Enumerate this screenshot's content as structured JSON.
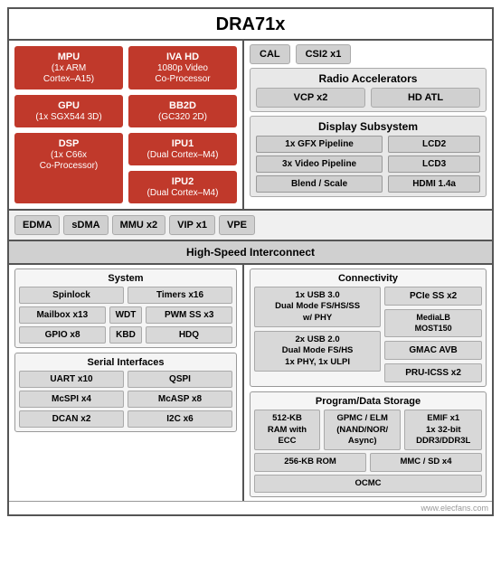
{
  "title": "DRA71x",
  "left_top": {
    "mpu": {
      "label": "MPU",
      "sub": "(1x ARM\nCortex–A15)"
    },
    "iva_hd": {
      "label": "IVA HD",
      "sub": "1080p Video\nCo-Processor"
    },
    "gpu": {
      "label": "GPU",
      "sub": "(1x SGX544 3D)"
    },
    "bb2d": {
      "label": "BB2D",
      "sub": "(GC320 2D)"
    },
    "dsp": {
      "label": "DSP",
      "sub": "(1x C66x\nCo-Processor)"
    },
    "ipu1": {
      "label": "IPU1",
      "sub": "(Dual Cortex–M4)"
    },
    "ipu2": {
      "label": "IPU2",
      "sub": "(Dual Cortex–M4)"
    }
  },
  "right_top": {
    "cal": "CAL",
    "csi2": "CSI2 x1",
    "radio_title": "Radio Accelerators",
    "vcp": "VCP x2",
    "hd_atl": "HD ATL",
    "display_title": "Display Subsystem",
    "gfx": "1x GFX Pipeline",
    "lcd2": "LCD2",
    "video": "3x Video Pipeline",
    "lcd3": "LCD3",
    "blend": "Blend / Scale",
    "hdmi": "HDMI 1.4a"
  },
  "bus": {
    "edma": "EDMA",
    "sdma": "sDMA",
    "mmu": "MMU x2",
    "vip": "VIP x1",
    "vpe": "VPE"
  },
  "interconnect": "High-Speed Interconnect",
  "system": {
    "title": "System",
    "row1": [
      "Spinlock",
      "Timers x16"
    ],
    "row2": [
      "Mailbox x13",
      "WDT",
      "PWM SS x3"
    ],
    "row3": [
      "GPIO x8",
      "KBD",
      "HDQ"
    ]
  },
  "serial": {
    "title": "Serial Interfaces",
    "row1": [
      "UART x10",
      "QSPI"
    ],
    "row2": [
      "McSPI x4",
      "McASP x8"
    ],
    "row3": [
      "DCAN x2",
      "I2C x6"
    ]
  },
  "connectivity": {
    "title": "Connectivity",
    "usb30": "1x USB 3.0\nDual Mode FS/HS/SS\nw/ PHY",
    "usb20": "2x USB 2.0\nDual Mode FS/HS\n1x PHY, 1x ULPI",
    "pcie": "PCIe SS x2",
    "medialb": "MediaLB\nMOST150",
    "gmac": "GMAC AVB",
    "pru": "PRU-ICSS x2"
  },
  "storage": {
    "title": "Program/Data Storage",
    "ram": "512-KB\nRAM with ECC",
    "gpmc": "GPMC / ELM\n(NAND/NOR/\nAsync)",
    "emif": "EMIF x1\n1x 32-bit\nDDR3/DDR3L",
    "rom": "256-KB ROM",
    "mmc": "MMC / SD x4",
    "ocmc": "OCMC"
  },
  "watermark": "www.elecfans.com"
}
